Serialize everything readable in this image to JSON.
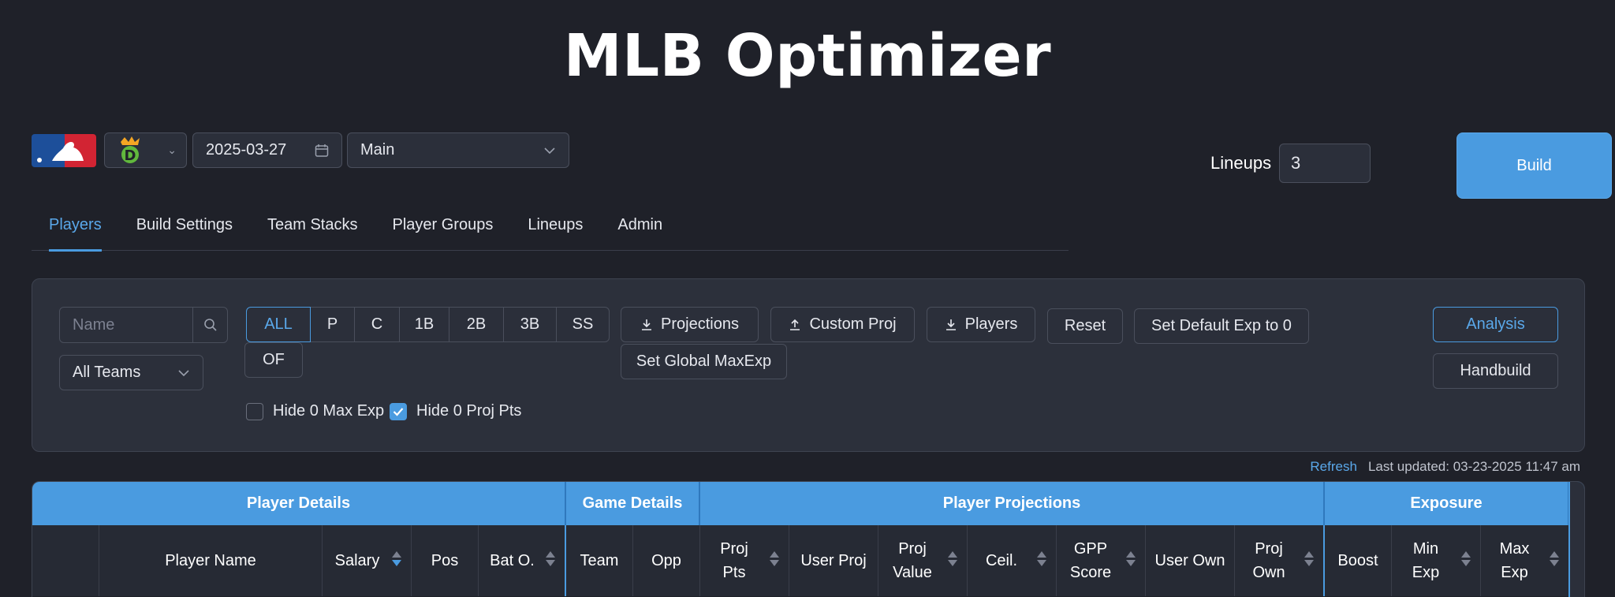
{
  "title": "MLB Optimizer",
  "header": {
    "date": "2025-03-27",
    "slate": "Main",
    "lineups_label": "Lineups",
    "lineups_value": "3",
    "build_label": "Build",
    "site_logo_text": "D"
  },
  "tabs": [
    "Players",
    "Build Settings",
    "Team Stacks",
    "Player Groups",
    "Lineups",
    "Admin"
  ],
  "filters": {
    "name_placeholder": "Name",
    "team_select": "All Teams",
    "positions": [
      "ALL",
      "P",
      "C",
      "1B",
      "2B",
      "3B",
      "SS",
      "OF"
    ],
    "hide_max_exp": "Hide 0 Max Exp",
    "hide_proj_pts": "Hide 0 Proj Pts",
    "hide_max_exp_checked": false,
    "hide_proj_pts_checked": true
  },
  "actions": {
    "projections": "Projections",
    "custom_proj": "Custom Proj",
    "players": "Players",
    "reset": "Reset",
    "set_default_exp": "Set Default Exp to 0",
    "set_global_maxexp": "Set Global MaxExp",
    "analysis": "Analysis",
    "handbuild": "Handbuild"
  },
  "refresh": {
    "link": "Refresh",
    "last_updated": "Last updated: 03-23-2025 11:47 am"
  },
  "table": {
    "groups": [
      "Player Details",
      "Game Details",
      "Player Projections",
      "Exposure"
    ],
    "columns": [
      "",
      "Player Name",
      "Salary",
      "Pos",
      "Bat O.",
      "Team",
      "Opp",
      "Proj Pts",
      "User Proj",
      "Proj Value",
      "Ceil.",
      "GPP Score",
      "User Own",
      "Proj Own",
      "Boost",
      "Min Exp",
      "Max Exp"
    ]
  },
  "colors": {
    "accent": "#4a9be0",
    "background": "#1f2129",
    "panel": "#2c303b"
  }
}
